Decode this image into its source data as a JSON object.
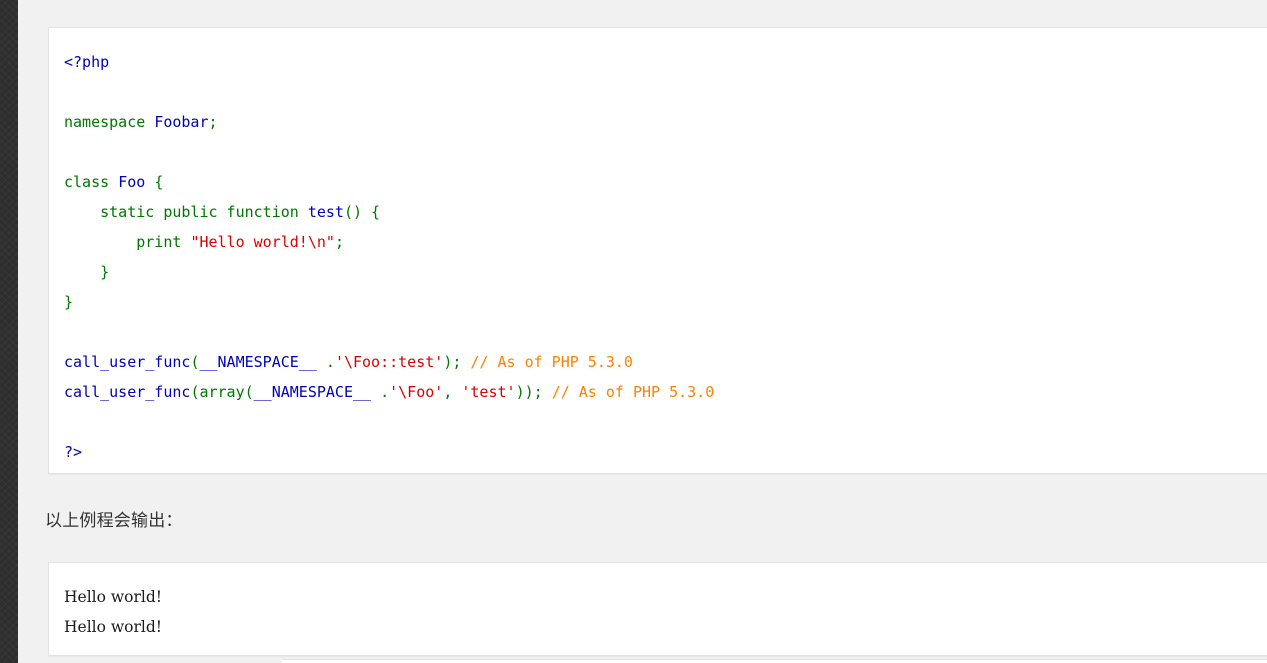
{
  "page": {
    "background_color": "#f1f1f1",
    "rail_color": "#2e2e2e"
  },
  "colors": {
    "tag": "#0000bb",
    "keyword": "#007700",
    "identifier": "#0000bb",
    "string": "#dd0000",
    "comment": "#ff8000",
    "box_background": "#ffffff",
    "box_border": "#e3e3e3",
    "text": "#333333"
  },
  "code_example": {
    "language": "php",
    "lines": [
      {
        "tokens": [
          {
            "t": "<?php",
            "c": "tag"
          }
        ]
      },
      {
        "tokens": []
      },
      {
        "tokens": [
          {
            "t": "namespace",
            "c": "keyword"
          },
          {
            "t": " ",
            "c": "default"
          },
          {
            "t": "Foobar",
            "c": "ident"
          },
          {
            "t": ";",
            "c": "keyword"
          }
        ]
      },
      {
        "tokens": []
      },
      {
        "tokens": [
          {
            "t": "class",
            "c": "keyword"
          },
          {
            "t": " ",
            "c": "default"
          },
          {
            "t": "Foo",
            "c": "ident"
          },
          {
            "t": " ",
            "c": "default"
          },
          {
            "t": "{",
            "c": "keyword"
          }
        ]
      },
      {
        "tokens": [
          {
            "t": "    static public function",
            "c": "keyword"
          },
          {
            "t": " ",
            "c": "default"
          },
          {
            "t": "test",
            "c": "ident"
          },
          {
            "t": "() {",
            "c": "keyword"
          }
        ]
      },
      {
        "tokens": [
          {
            "t": "        print",
            "c": "keyword"
          },
          {
            "t": " ",
            "c": "default"
          },
          {
            "t": "\"Hello world!\\n\"",
            "c": "string"
          },
          {
            "t": ";",
            "c": "keyword"
          }
        ]
      },
      {
        "tokens": [
          {
            "t": "    }",
            "c": "keyword"
          }
        ]
      },
      {
        "tokens": [
          {
            "t": "}",
            "c": "keyword"
          }
        ]
      },
      {
        "tokens": []
      },
      {
        "tokens": [
          {
            "t": "call_user_func",
            "c": "ident"
          },
          {
            "t": "(",
            "c": "keyword"
          },
          {
            "t": "__NAMESPACE__",
            "c": "ident"
          },
          {
            "t": " .",
            "c": "keyword"
          },
          {
            "t": "'\\Foo::test'",
            "c": "string"
          },
          {
            "t": "); ",
            "c": "keyword"
          },
          {
            "t": "// As of PHP 5.3.0",
            "c": "comment"
          }
        ]
      },
      {
        "tokens": [
          {
            "t": "call_user_func",
            "c": "ident"
          },
          {
            "t": "(array(",
            "c": "keyword"
          },
          {
            "t": "__NAMESPACE__",
            "c": "ident"
          },
          {
            "t": " .",
            "c": "keyword"
          },
          {
            "t": "'\\Foo'",
            "c": "string"
          },
          {
            "t": ", ",
            "c": "keyword"
          },
          {
            "t": "'test'",
            "c": "string"
          },
          {
            "t": ")); ",
            "c": "keyword"
          },
          {
            "t": "// As of PHP 5.3.0",
            "c": "comment"
          }
        ]
      },
      {
        "tokens": []
      },
      {
        "tokens": [
          {
            "t": "?>",
            "c": "tag"
          }
        ]
      }
    ]
  },
  "note": {
    "text": "以上例程会输出："
  },
  "output_example": {
    "lines": [
      "Hello world!",
      "Hello world!"
    ]
  }
}
